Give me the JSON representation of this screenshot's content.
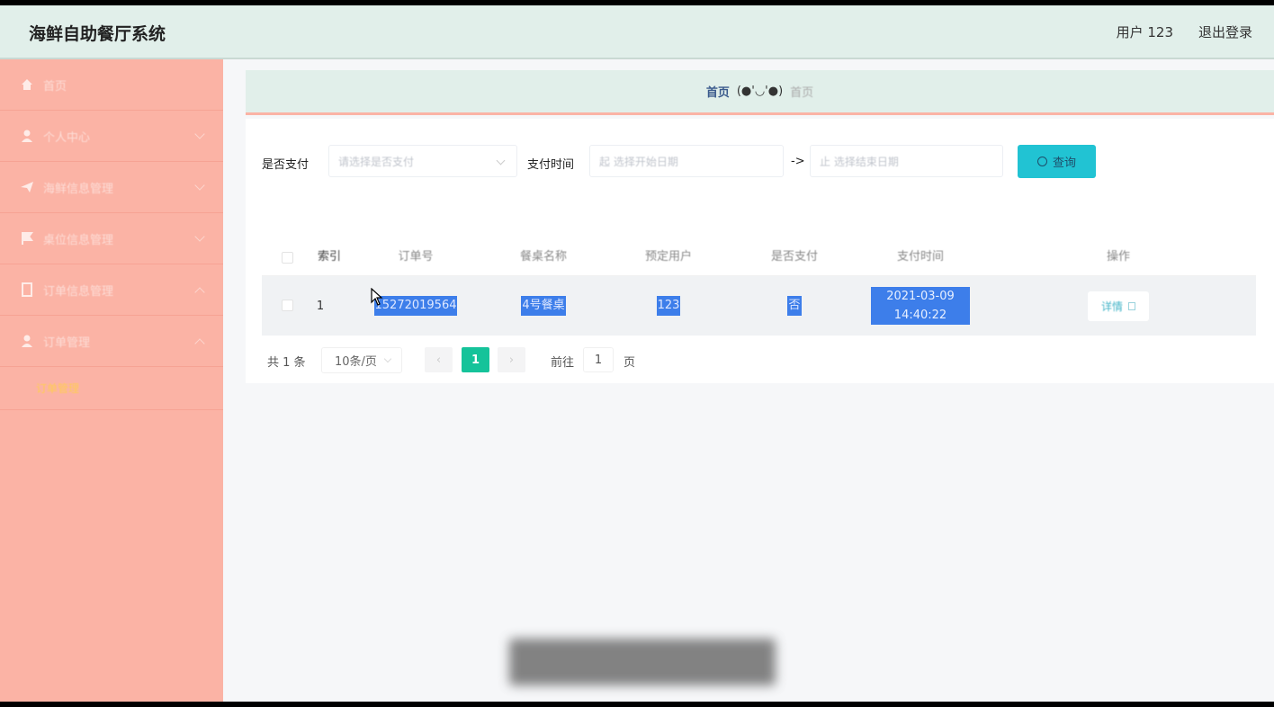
{
  "header": {
    "title": "海鲜自助餐厅系统",
    "user": "用户 123",
    "logout": "退出登录"
  },
  "sidebar": {
    "items": [
      {
        "label": "首页",
        "icon": "home-icon"
      },
      {
        "label": "个人中心",
        "icon": "person-icon"
      },
      {
        "label": "海鲜信息管理",
        "icon": "send-icon"
      },
      {
        "label": "桌位信息管理",
        "icon": "flag-icon"
      },
      {
        "label": "订单信息管理",
        "icon": "document-icon"
      },
      {
        "label": "订单管理",
        "icon": "person-icon"
      }
    ],
    "sub_item": "订单管理"
  },
  "breadcrumb": {
    "home": "首页",
    "face": "(●'◡'●)",
    "current": "首页"
  },
  "filters": {
    "paid_label": "是否支付",
    "paid_placeholder": "请选择是否支付",
    "time_label": "支付时间",
    "start_placeholder": "起 选择开始日期",
    "separator": "->",
    "end_placeholder": "止 选择结束日期",
    "search_label": "查询"
  },
  "table": {
    "headers": [
      "索引",
      "订单号",
      "餐桌名称",
      "预定用户",
      "是否支付",
      "支付时间",
      "操作"
    ],
    "rows": [
      {
        "index": "1",
        "order_no": "15272019564",
        "table_name": "4号餐桌",
        "user": "123",
        "paid": "否",
        "pay_time": "2021-03-09 14:40:22",
        "action": "详情"
      }
    ]
  },
  "pagination": {
    "total": "共 1 条",
    "page_size": "10条/页",
    "current_page": "1",
    "goto_label": "前往",
    "goto_value": "1",
    "page_unit": "页"
  },
  "colors": {
    "header_bg": "#e1efea",
    "sidebar_bg": "#fbb3a5",
    "search_button": "#21c3d3",
    "active_page": "#15c39a",
    "selection": "#3d7eea"
  }
}
